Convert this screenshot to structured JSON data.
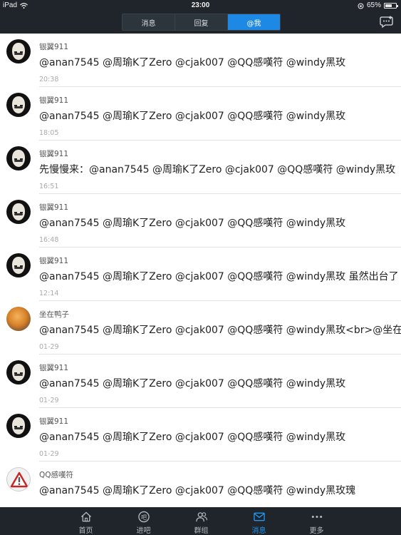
{
  "statusbar": {
    "device": "iPad",
    "time": "23:00",
    "battery": "65%",
    "battery_level": 0.65
  },
  "navbar": {
    "tabs": [
      {
        "label": "消息",
        "active": false
      },
      {
        "label": "回复",
        "active": false
      },
      {
        "label": "@我",
        "active": true
      }
    ]
  },
  "feed": {
    "items": [
      {
        "user": "银翼911",
        "avatar": "mask-avatar",
        "content": "@anan7545 @周瑜K了Zero @cjak007 @QQ感嘆符 @windy黑玫",
        "time": "20:38"
      },
      {
        "user": "银翼911",
        "avatar": "mask-avatar",
        "content": "@anan7545 @周瑜K了Zero @cjak007 @QQ感嘆符 @windy黑玫",
        "time": "18:05"
      },
      {
        "user": "银翼911",
        "avatar": "mask-avatar",
        "content": "先慢慢来：@anan7545 @周瑜K了Zero @cjak007 @QQ感嘆符 @windy黑玫",
        "time": "16:51"
      },
      {
        "user": "银翼911",
        "avatar": "mask-avatar",
        "content": "@anan7545 @周瑜K了Zero @cjak007 @QQ感嘆符 @windy黑玫",
        "time": "16:48"
      },
      {
        "user": "银翼911",
        "avatar": "mask-avatar",
        "content": "@anan7545 @周瑜K了Zero @cjak007 @QQ感嘆符  @windy黑玫 虽然出台了",
        "time": "12:14"
      },
      {
        "user": "坐在鸭子",
        "avatar": "duck-avatar",
        "content": "@anan7545 @周瑜K了Zero @cjak007 @QQ感嘆符  @windy黑玫<br>@坐在",
        "time": "01-29"
      },
      {
        "user": "银翼911",
        "avatar": "mask-avatar",
        "content": "@anan7545 @周瑜K了Zero @cjak007 @QQ感嘆符 @windy黑玫",
        "time": "01-29"
      },
      {
        "user": "银翼911",
        "avatar": "mask-avatar",
        "content": "@anan7545 @周瑜K了Zero @cjak007 @QQ感嘆符 @windy黑玫",
        "time": "01-29"
      },
      {
        "user": "QQ感嘆符",
        "avatar": "warning-avatar",
        "content": "@anan7545 @周瑜K了Zero @cjak007 @QQ感嘆符 @windy黑玫瑰",
        "time": ""
      }
    ]
  },
  "tabbar": {
    "items": [
      {
        "label": "首页",
        "icon": "home-icon",
        "active": false
      },
      {
        "label": "进吧",
        "icon": "ba-icon",
        "active": false
      },
      {
        "label": "群组",
        "icon": "group-icon",
        "active": false
      },
      {
        "label": "消息",
        "icon": "message-icon",
        "active": true
      },
      {
        "label": "更多",
        "icon": "more-icon",
        "active": false
      }
    ]
  },
  "colors": {
    "bar_bg": "#1f252b",
    "accent": "#1e88e5",
    "divider": "#e3e3e3"
  }
}
